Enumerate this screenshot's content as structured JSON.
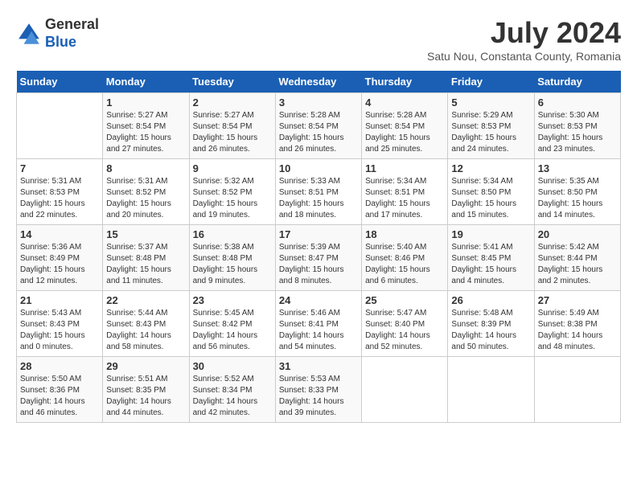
{
  "header": {
    "logo_general": "General",
    "logo_blue": "Blue",
    "month_title": "July 2024",
    "location": "Satu Nou, Constanta County, Romania"
  },
  "calendar": {
    "days_of_week": [
      "Sunday",
      "Monday",
      "Tuesday",
      "Wednesday",
      "Thursday",
      "Friday",
      "Saturday"
    ],
    "weeks": [
      [
        {
          "day": "",
          "info": ""
        },
        {
          "day": "1",
          "info": "Sunrise: 5:27 AM\nSunset: 8:54 PM\nDaylight: 15 hours\nand 27 minutes."
        },
        {
          "day": "2",
          "info": "Sunrise: 5:27 AM\nSunset: 8:54 PM\nDaylight: 15 hours\nand 26 minutes."
        },
        {
          "day": "3",
          "info": "Sunrise: 5:28 AM\nSunset: 8:54 PM\nDaylight: 15 hours\nand 26 minutes."
        },
        {
          "day": "4",
          "info": "Sunrise: 5:28 AM\nSunset: 8:54 PM\nDaylight: 15 hours\nand 25 minutes."
        },
        {
          "day": "5",
          "info": "Sunrise: 5:29 AM\nSunset: 8:53 PM\nDaylight: 15 hours\nand 24 minutes."
        },
        {
          "day": "6",
          "info": "Sunrise: 5:30 AM\nSunset: 8:53 PM\nDaylight: 15 hours\nand 23 minutes."
        }
      ],
      [
        {
          "day": "7",
          "info": "Sunrise: 5:31 AM\nSunset: 8:53 PM\nDaylight: 15 hours\nand 22 minutes."
        },
        {
          "day": "8",
          "info": "Sunrise: 5:31 AM\nSunset: 8:52 PM\nDaylight: 15 hours\nand 20 minutes."
        },
        {
          "day": "9",
          "info": "Sunrise: 5:32 AM\nSunset: 8:52 PM\nDaylight: 15 hours\nand 19 minutes."
        },
        {
          "day": "10",
          "info": "Sunrise: 5:33 AM\nSunset: 8:51 PM\nDaylight: 15 hours\nand 18 minutes."
        },
        {
          "day": "11",
          "info": "Sunrise: 5:34 AM\nSunset: 8:51 PM\nDaylight: 15 hours\nand 17 minutes."
        },
        {
          "day": "12",
          "info": "Sunrise: 5:34 AM\nSunset: 8:50 PM\nDaylight: 15 hours\nand 15 minutes."
        },
        {
          "day": "13",
          "info": "Sunrise: 5:35 AM\nSunset: 8:50 PM\nDaylight: 15 hours\nand 14 minutes."
        }
      ],
      [
        {
          "day": "14",
          "info": "Sunrise: 5:36 AM\nSunset: 8:49 PM\nDaylight: 15 hours\nand 12 minutes."
        },
        {
          "day": "15",
          "info": "Sunrise: 5:37 AM\nSunset: 8:48 PM\nDaylight: 15 hours\nand 11 minutes."
        },
        {
          "day": "16",
          "info": "Sunrise: 5:38 AM\nSunset: 8:48 PM\nDaylight: 15 hours\nand 9 minutes."
        },
        {
          "day": "17",
          "info": "Sunrise: 5:39 AM\nSunset: 8:47 PM\nDaylight: 15 hours\nand 8 minutes."
        },
        {
          "day": "18",
          "info": "Sunrise: 5:40 AM\nSunset: 8:46 PM\nDaylight: 15 hours\nand 6 minutes."
        },
        {
          "day": "19",
          "info": "Sunrise: 5:41 AM\nSunset: 8:45 PM\nDaylight: 15 hours\nand 4 minutes."
        },
        {
          "day": "20",
          "info": "Sunrise: 5:42 AM\nSunset: 8:44 PM\nDaylight: 15 hours\nand 2 minutes."
        }
      ],
      [
        {
          "day": "21",
          "info": "Sunrise: 5:43 AM\nSunset: 8:43 PM\nDaylight: 15 hours\nand 0 minutes."
        },
        {
          "day": "22",
          "info": "Sunrise: 5:44 AM\nSunset: 8:43 PM\nDaylight: 14 hours\nand 58 minutes."
        },
        {
          "day": "23",
          "info": "Sunrise: 5:45 AM\nSunset: 8:42 PM\nDaylight: 14 hours\nand 56 minutes."
        },
        {
          "day": "24",
          "info": "Sunrise: 5:46 AM\nSunset: 8:41 PM\nDaylight: 14 hours\nand 54 minutes."
        },
        {
          "day": "25",
          "info": "Sunrise: 5:47 AM\nSunset: 8:40 PM\nDaylight: 14 hours\nand 52 minutes."
        },
        {
          "day": "26",
          "info": "Sunrise: 5:48 AM\nSunset: 8:39 PM\nDaylight: 14 hours\nand 50 minutes."
        },
        {
          "day": "27",
          "info": "Sunrise: 5:49 AM\nSunset: 8:38 PM\nDaylight: 14 hours\nand 48 minutes."
        }
      ],
      [
        {
          "day": "28",
          "info": "Sunrise: 5:50 AM\nSunset: 8:36 PM\nDaylight: 14 hours\nand 46 minutes."
        },
        {
          "day": "29",
          "info": "Sunrise: 5:51 AM\nSunset: 8:35 PM\nDaylight: 14 hours\nand 44 minutes."
        },
        {
          "day": "30",
          "info": "Sunrise: 5:52 AM\nSunset: 8:34 PM\nDaylight: 14 hours\nand 42 minutes."
        },
        {
          "day": "31",
          "info": "Sunrise: 5:53 AM\nSunset: 8:33 PM\nDaylight: 14 hours\nand 39 minutes."
        },
        {
          "day": "",
          "info": ""
        },
        {
          "day": "",
          "info": ""
        },
        {
          "day": "",
          "info": ""
        }
      ]
    ]
  }
}
